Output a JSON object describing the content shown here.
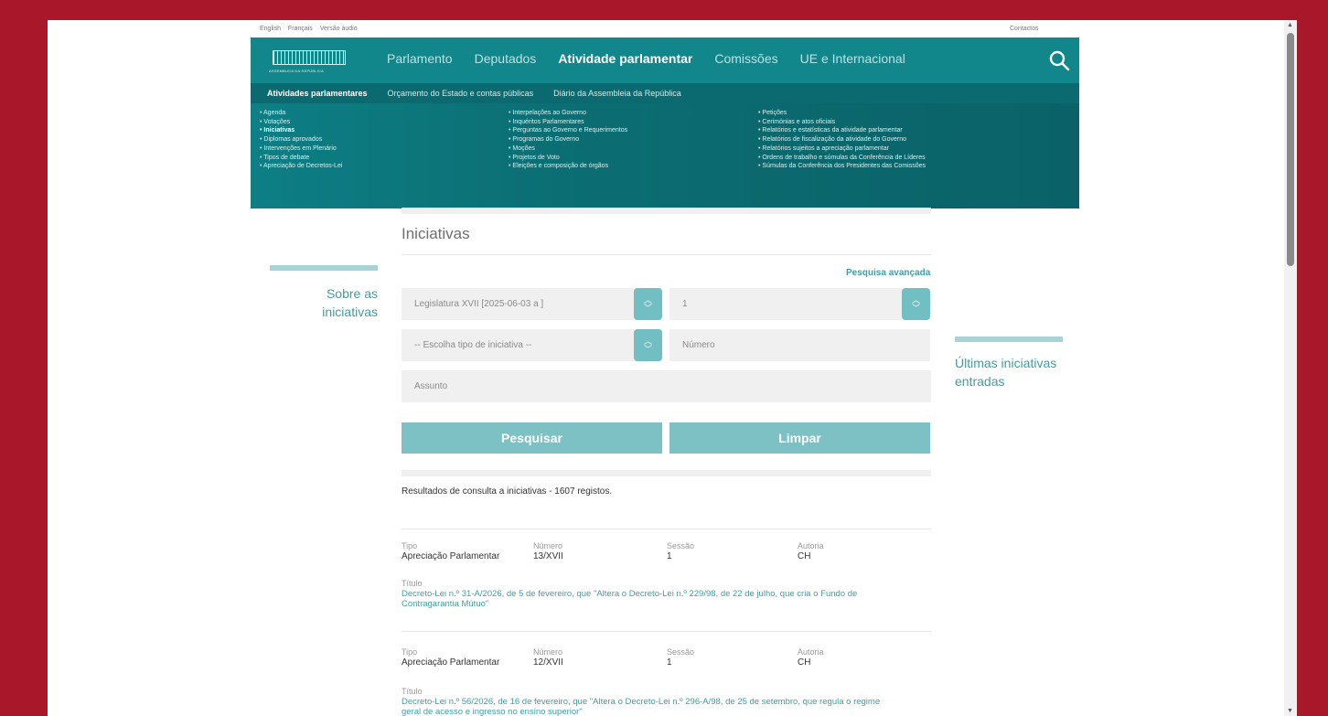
{
  "top_links": [
    "English",
    "Français",
    "Versão áudio"
  ],
  "contactos": "Contactos",
  "logo_text": "ASSEMBLEIA DA REPÚBLICA",
  "main_nav": [
    {
      "label": "Parlamento"
    },
    {
      "label": "Deputados"
    },
    {
      "label": "Atividade parlamentar",
      "active": true
    },
    {
      "label": "Comissões"
    },
    {
      "label": "UE e Internacional"
    }
  ],
  "sub_nav": [
    {
      "label": "Atividades parlamentares",
      "active": true
    },
    {
      "label": "Orçamento do Estado e contas públicas"
    },
    {
      "label": "Diário da Assembleia da República"
    }
  ],
  "menu_col1": [
    "Agenda",
    "Votações",
    "Iniciativas",
    "Diplomas aprovados",
    "Intervenções em Plenário",
    "Tipos de debate",
    "Apreciação de Decretos-Lei"
  ],
  "menu_col2": [
    "Interpelações ao Governo",
    "Inquéritos Parlamentares",
    "Perguntas ao Governo e Requerimentos",
    "Programas do Governo",
    "Moções",
    "Projetos de Voto",
    "Eleições e composição de órgãos"
  ],
  "menu_col3": [
    "Petições",
    "Cerimónias e atos oficiais",
    "Relatórios e estatísticas da atividade parlamentar",
    "Relatórios de fiscalização da atividade do Governo",
    "Relatórios sujeitos a apreciação parlamentar",
    "Ordens de trabalho e súmulas da Conferência de Líderes",
    "Súmulas da Conferência dos Presidentes das Comissões"
  ],
  "page_title": "Iniciativas",
  "advanced_search": "Pesquisa avançada",
  "legislatura_value": "Legislatura XVII [2025-06-03 a ]",
  "sessao_value": "1",
  "tipo_placeholder": "-- Escolha tipo de iniciativa --",
  "numero_placeholder": "Número",
  "assunto_placeholder": "Assunto",
  "search_button": "Pesquisar",
  "clear_button": "Limpar",
  "left_link": [
    "Sobre as",
    "iniciativas"
  ],
  "right_link": [
    "Últimas iniciativas",
    "entradas"
  ],
  "results_text": "Resultados de consulta a iniciativas - 1607 registos.",
  "labels": {
    "tipo": "Tipo",
    "numero": "Número",
    "sessao": "Sessão",
    "autoria": "Autoria",
    "titulo": "Título"
  },
  "items": [
    {
      "tipo": "Apreciação Parlamentar",
      "numero": "13/XVII",
      "sessao": "1",
      "autoria": "CH",
      "titulo_l1": "Decreto-Lei n.º 31-A/2026, de 5 de fevereiro, que \"Altera o Decreto-Lei n.º 229/98, de 22 de julho, que cria o Fundo de",
      "titulo_l2": "Contragarantia Mútuo\""
    },
    {
      "tipo": "Apreciação Parlamentar",
      "numero": "12/XVII",
      "sessao": "1",
      "autoria": "CH",
      "titulo_l1": "Decreto-Lei n.º 56/2026, de 16 de fevereiro, que \"Altera o Decreto-Lei n.º 296-A/98, de 25 de setembro, que regula o regime",
      "titulo_l2": "geral de acesso e ingresso no ensino superior\""
    }
  ]
}
